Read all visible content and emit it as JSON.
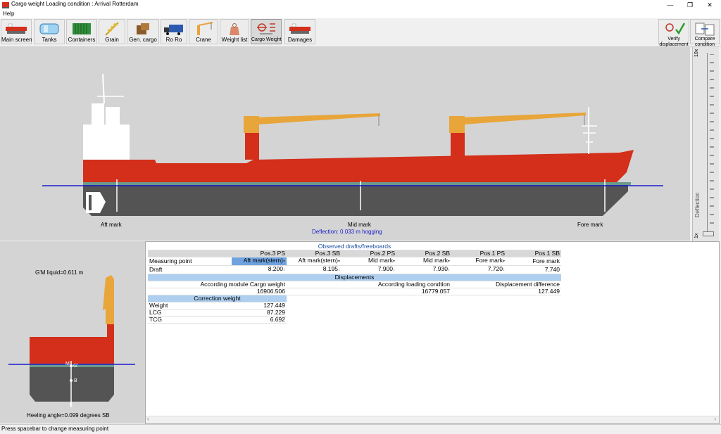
{
  "window": {
    "title": "Cargo weight  Loading condition : Arrival  Rotterdam",
    "minimize": "—",
    "restore": "❐",
    "close": "✕"
  },
  "menu": {
    "help": "Help"
  },
  "toolbar": {
    "buttons": [
      {
        "label": "Main screen",
        "icon": "ship-icon"
      },
      {
        "label": "Tanks",
        "icon": "tanks-icon"
      },
      {
        "label": "Containers",
        "icon": "container-icon"
      },
      {
        "label": "Grain",
        "icon": "grain-icon"
      },
      {
        "label": "Gen. cargo",
        "icon": "general-cargo-icon"
      },
      {
        "label": "Ro Ro",
        "icon": "truck-icon"
      },
      {
        "label": "Crane",
        "icon": "crane-icon"
      },
      {
        "label": "Weight list",
        "icon": "weight-icon"
      },
      {
        "label": "Cargo Weight",
        "icon": "cargo-weight-icon"
      },
      {
        "label": "Damages",
        "icon": "damaged-ship-icon"
      }
    ],
    "verify": "Verify displacement",
    "compare": "Compare condition"
  },
  "ship": {
    "aft_mark": "Aft mark",
    "mid_mark": "Mid mark",
    "fore_mark": "Fore mark",
    "deflection": "Deflection: 0.033 m hogging"
  },
  "slider": {
    "top_label": "10x",
    "bottom_label": "1x",
    "title": "Deflection"
  },
  "section": {
    "gm": "G'M liquid=0.611 m",
    "heeling": "Heeling angle=0.099 degrees SB",
    "labels": {
      "m": "M",
      "g": "G'",
      "b": "B",
      "k": "K"
    }
  },
  "table": {
    "caption": "Observed drafts/freeboards",
    "columns": [
      "Pos.3 PS",
      "Pos.3 SB",
      "Pos.2 PS",
      "Pos.2 SB",
      "Pos.1 PS",
      "Pos.1 SB"
    ],
    "measuring_label": "Measuring point",
    "measuring": [
      "Aft mark(stern)",
      "Aft mark(stern)",
      "Mid mark",
      "Mid mark",
      "Fore mark",
      "Fore mark"
    ],
    "draft_label": "Draft",
    "drafts": [
      "8.200",
      "8.195",
      "7.900",
      "7.930",
      "7.720",
      "7.740"
    ],
    "displacements": "Displacements",
    "disp_heads": [
      "According module Cargo weight",
      "According loading condtion",
      "Displacement difference"
    ],
    "disp_values": [
      "16906.506",
      "16779.057",
      "127.449"
    ],
    "correction": "Correction weight",
    "corr_rows": [
      {
        "label": "Weight",
        "value": "127.449"
      },
      {
        "label": "LCG",
        "value": "87.229"
      },
      {
        "label": "TCG",
        "value": "6.692"
      }
    ]
  },
  "status": "Press spacebar to change measuring point",
  "colors": {
    "hull_red": "#d32f1a",
    "hull_grey": "#545454",
    "crane": "#e8a53a",
    "waterline": "#1a1acc",
    "stripe": "#6a9a8a"
  }
}
